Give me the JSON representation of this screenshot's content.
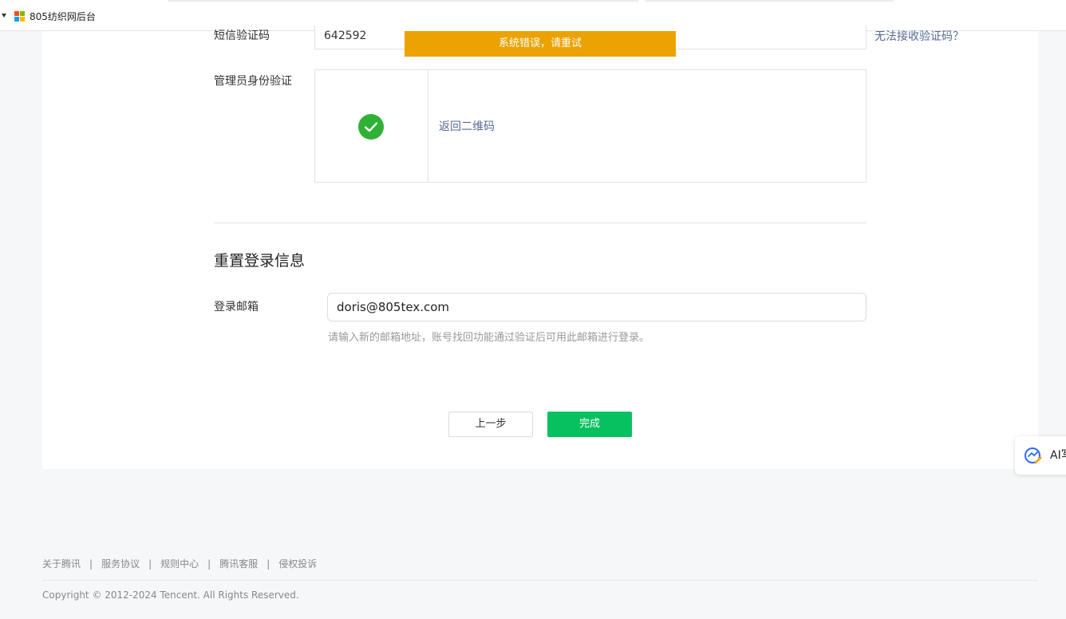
{
  "browser_tab": {
    "title": "805纺织网后台"
  },
  "verification": {
    "sms_label": "短信验证码",
    "sms_value": "642592",
    "sms_help_link": "无法接收验证码？",
    "toast": "系统错误，请重试",
    "admin_label": "管理员身份验证",
    "back_qr_link": "返回二维码",
    "status_icon": "check-circle-icon",
    "success_color": "#2eb135"
  },
  "reset": {
    "section_title": "重置登录信息",
    "email_label": "登录邮箱",
    "email_value": "doris@805tex.com",
    "email_hint": "请输入新的邮箱地址，账号找回功能通过验证后可用此邮箱进行登录。"
  },
  "actions": {
    "prev_label": "上一步",
    "done_label": "完成",
    "done_color": "#07c160"
  },
  "ai_widget": {
    "label": "AI写"
  },
  "footer": {
    "links": [
      "关于腾讯",
      "服务协议",
      "规则中心",
      "腾讯客服",
      "侵权投诉"
    ],
    "separator": "|",
    "copyright": "Copyright © 2012-2024 Tencent. All Rights Reserved."
  }
}
